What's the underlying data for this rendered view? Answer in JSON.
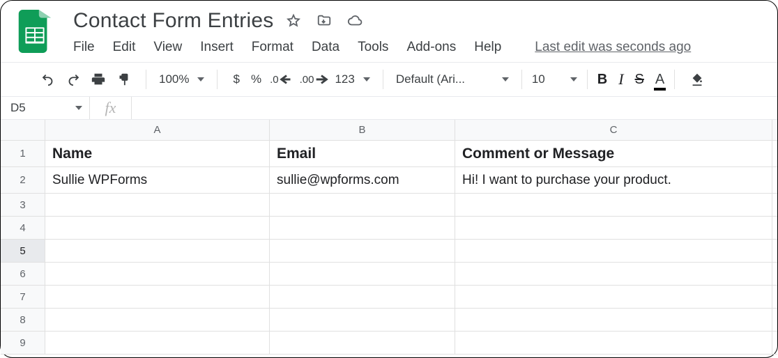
{
  "header": {
    "title": "Contact Form Entries",
    "menu": [
      "File",
      "Edit",
      "View",
      "Insert",
      "Format",
      "Data",
      "Tools",
      "Add-ons",
      "Help"
    ],
    "last_edit": "Last edit was seconds ago"
  },
  "toolbar": {
    "zoom": "100%",
    "currency": "$",
    "percent": "%",
    "dec_dec": ".0",
    "dec_inc": ".00",
    "num_format": "123",
    "font": "Default (Ari...",
    "font_size": "10",
    "bold": "B",
    "italic": "I",
    "strike": "S",
    "text_color": "A"
  },
  "namebox": {
    "ref": "D5"
  },
  "fx": {
    "value": ""
  },
  "columns": [
    "A",
    "B",
    "C"
  ],
  "rows": [
    "1",
    "2",
    "3",
    "4",
    "5",
    "6",
    "7",
    "8",
    "9"
  ],
  "selected_row": "5",
  "data": {
    "r1": {
      "A": "Name",
      "B": "Email",
      "C": "Comment or Message"
    },
    "r2": {
      "A": "Sullie WPForms",
      "B": "sullie@wpforms.com",
      "C": "Hi! I want to purchase your product."
    },
    "r3": {
      "A": "",
      "B": "",
      "C": ""
    },
    "r4": {
      "A": "",
      "B": "",
      "C": ""
    },
    "r5": {
      "A": "",
      "B": "",
      "C": ""
    },
    "r6": {
      "A": "",
      "B": "",
      "C": ""
    },
    "r7": {
      "A": "",
      "B": "",
      "C": ""
    },
    "r8": {
      "A": "",
      "B": "",
      "C": ""
    },
    "r9": {
      "A": "",
      "B": "",
      "C": ""
    }
  }
}
